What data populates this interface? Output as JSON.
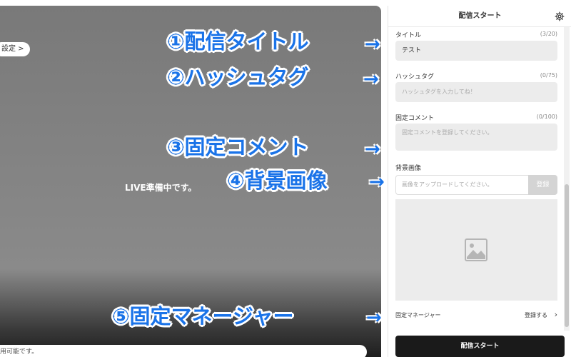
{
  "preview": {
    "settings_pill": "設定 >",
    "status_text": "LIVE準備中です。",
    "bottom_text": "用可能です。"
  },
  "panel": {
    "header_title": "配信スタート",
    "title_field": {
      "label": "タイトル",
      "counter": "(3/20)",
      "value": "テスト"
    },
    "hashtag_field": {
      "label": "ハッシュタグ",
      "counter": "(0/75)",
      "placeholder": "ハッシュタグを入力してね！"
    },
    "pinned_comment_field": {
      "label": "固定コメント",
      "counter": "(0/100)",
      "placeholder": "固定コメントを登録してください。"
    },
    "background_field": {
      "label": "背景画像",
      "placeholder": "画像をアップロードしてください。",
      "button": "登録"
    },
    "manager_row": {
      "label": "固定マネージャー",
      "link": "登録する",
      "chevron": "›"
    },
    "start_button": "配信スタート"
  },
  "annotations": [
    {
      "text": "①配信タイトル"
    },
    {
      "text": "②ハッシュタグ"
    },
    {
      "text": "③固定コメント"
    },
    {
      "text": "④背景画像"
    },
    {
      "text": "⑤固定マネージャー"
    }
  ],
  "arrow_glyph": "→",
  "colors": {
    "annotation": "#1a73e8",
    "start_button": "#1a1a1a",
    "field_bg": "#ececec"
  }
}
